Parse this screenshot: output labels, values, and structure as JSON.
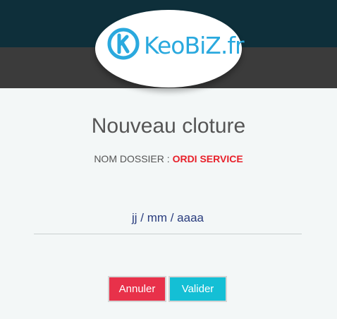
{
  "header": {
    "logo": {
      "icon": "keobiz-k-circle-icon",
      "text": "KeoBiZ.fr"
    }
  },
  "form": {
    "title": "Nouveau cloture",
    "dossier_label": "NOM DOSSIER :",
    "dossier_value": "ORDI SERVICE",
    "date_placeholder": "jj / mm / aaaa",
    "cancel_label": "Annuler",
    "validate_label": "Valider"
  },
  "colors": {
    "header_top": "#0e2f3a",
    "header_band": "#3b3b3b",
    "brand_blue": "#2aa9de",
    "dossier_red": "#e8202a",
    "cancel_red": "#e8314a",
    "validate_cyan": "#14bfd5"
  }
}
